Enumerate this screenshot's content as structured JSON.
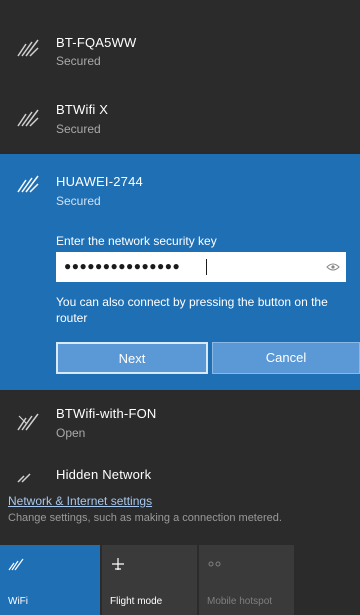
{
  "networks": [
    {
      "ssid": "BT-FQA5WW",
      "status": "Secured"
    },
    {
      "ssid": "BTWifi X",
      "status": "Secured"
    },
    {
      "ssid": "HUAWEI-2744",
      "status": "Secured",
      "key_label": "Enter the network security key",
      "key_value": "●●●●●●●●●●●●●●●",
      "hint": "You can also connect by pressing the button on the router",
      "next_label": "Next",
      "cancel_label": "Cancel"
    },
    {
      "ssid": "BTWifi-with-FON",
      "status": "Open"
    },
    {
      "ssid": "Hidden Network",
      "status": ""
    }
  ],
  "settings": {
    "link": "Network & Internet settings",
    "description": "Change settings, such as making a connection metered."
  },
  "quick_actions": [
    {
      "label": "WiFi",
      "icon": "wifi-icon",
      "active": true
    },
    {
      "label": "Flight mode",
      "icon": "airplane-icon",
      "active": false
    },
    {
      "label": "Mobile hotspot",
      "icon": "hotspot-icon",
      "active": false,
      "disabled": true
    }
  ],
  "colors": {
    "accent": "#1f6fb5",
    "panel": "#2b2b2b",
    "tile": "#3a3a3a"
  }
}
